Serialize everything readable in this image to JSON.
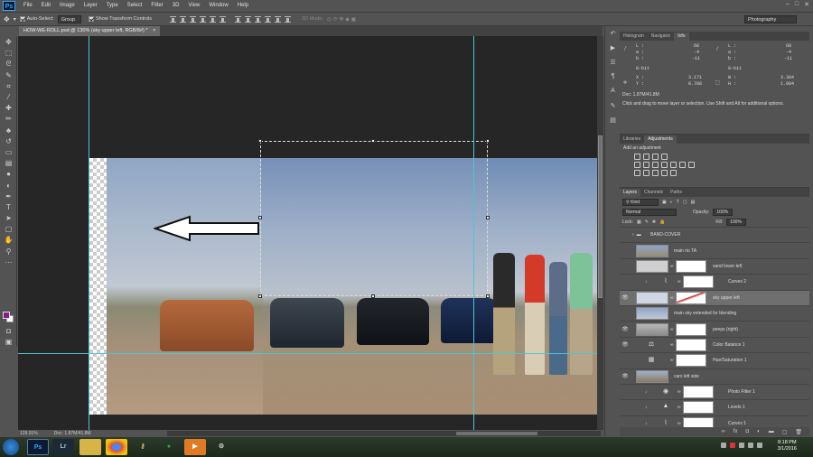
{
  "menu": [
    "File",
    "Edit",
    "Image",
    "Layer",
    "Type",
    "Select",
    "Filter",
    "3D",
    "View",
    "Window",
    "Help"
  ],
  "app_logo": "Ps",
  "options": {
    "auto_select_label": "Auto-Select:",
    "auto_select_value": "Group",
    "show_transform_label": "Show Transform Controls",
    "mode3d_label": "3D Mode:",
    "workspace": "Photography"
  },
  "document_tab": "HOW-WE-ROLL.psd @ 130% (sky upper left, RGB/8#) *",
  "status": {
    "zoom": "129.91%",
    "doc": "Doc: 1.87M/41.8M"
  },
  "info_panel": {
    "tabs": [
      "Histogram",
      "Navigator",
      "Info"
    ],
    "active_tab": "Info",
    "left_col": {
      "L": "L :",
      "L_val": "68",
      "a": "a :",
      "a_val": "-4",
      "b": "b :",
      "b_val": "-11",
      "bit": "8-bit"
    },
    "right_col": {
      "L": "L :",
      "L_val": "68",
      "a": "a :",
      "a_val": "-4",
      "b": "b :",
      "b_val": "-11",
      "bit": "8-bit"
    },
    "x_label": "X :",
    "x_val": "3.171",
    "y_label": "Y :",
    "y_val": "0.788",
    "w_label": "W :",
    "w_val": "3.304",
    "h_label": "H :",
    "h_val": "1.984",
    "doc": "Doc: 1.87M/41.8M",
    "hint": "Click and drag to move layer or selection.  Use Shift and Alt for additional options."
  },
  "adjustments_panel": {
    "tabs": [
      "Libraries",
      "Adjustments"
    ],
    "active_tab": "Adjustments",
    "add_label": "Add an adjustment"
  },
  "layers_panel": {
    "tabs": [
      "Layers",
      "Channels",
      "Paths"
    ],
    "active_tab": "Layers",
    "kind_label": "Kind",
    "blend_mode": "Normal",
    "opacity_label": "Opacity:",
    "opacity": "100%",
    "lock_label": "Lock:",
    "fill_label": "Fill:",
    "fill": "100%",
    "layers": [
      {
        "name": "BAND-COVER",
        "type": "group"
      },
      {
        "name": "main rio TA",
        "type": "pixel"
      },
      {
        "name": "sand lower left",
        "type": "pixel_mask"
      },
      {
        "name": "Curves 2",
        "type": "adjustment"
      },
      {
        "name": "sky upper left",
        "type": "pixel_mask",
        "selected": true
      },
      {
        "name": "main sky extended for blending",
        "type": "pixel"
      },
      {
        "name": "peeps (right)",
        "type": "pixel_mask"
      },
      {
        "name": "Color Balance 1",
        "type": "adjustment"
      },
      {
        "name": "Hue/Saturation 1",
        "type": "adjustment"
      },
      {
        "name": "cars left side",
        "type": "pixel"
      },
      {
        "name": "Photo Filter 1",
        "type": "adjustment"
      },
      {
        "name": "Levels 1",
        "type": "adjustment"
      },
      {
        "name": "Curves 1",
        "type": "adjustment"
      }
    ]
  },
  "taskbar": {
    "apps": [
      "Ps",
      "Lr"
    ],
    "time": "8:18 PM",
    "date": "3/1/2016"
  },
  "colors": {
    "foreground": "#8b1a8b",
    "background": "#ffffff",
    "guide": "#4fc3d6"
  }
}
